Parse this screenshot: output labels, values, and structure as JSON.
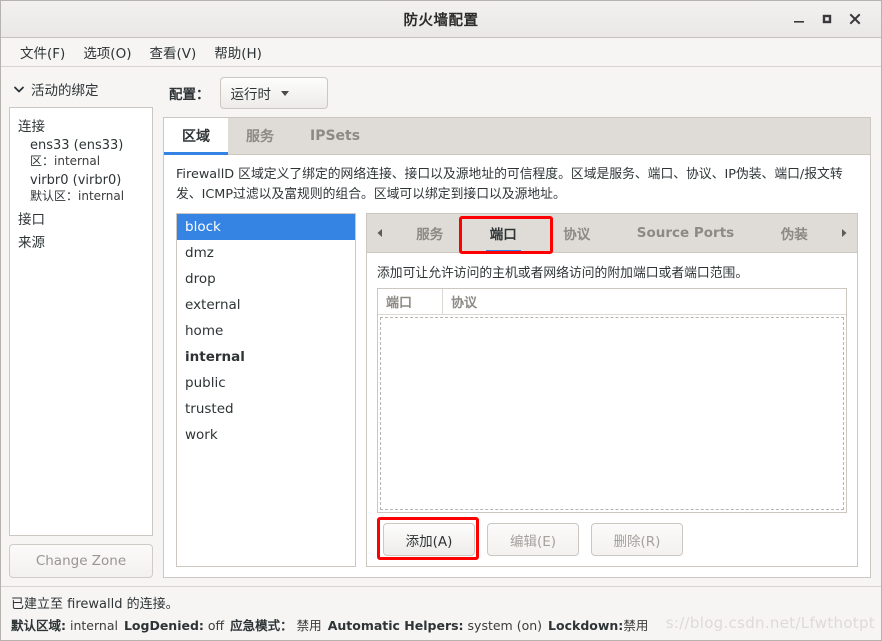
{
  "window": {
    "title": "防火墙配置",
    "controls": {
      "minimize": "—",
      "maximize": "□",
      "close": "✕"
    }
  },
  "menubar": {
    "items": [
      {
        "label": "文件(F)"
      },
      {
        "label": "选项(O)"
      },
      {
        "label": "查看(V)"
      },
      {
        "label": "帮助(H)"
      }
    ]
  },
  "sidebar": {
    "header": "活动的绑定",
    "groups": [
      {
        "title": "连接"
      },
      {
        "title": "接口"
      },
      {
        "title": "来源"
      }
    ],
    "connections": [
      {
        "name": "ens33 (ens33)",
        "sub_label": "区：",
        "sub_value": "internal"
      },
      {
        "name": "virbr0 (virbr0)",
        "sub_label": "默认区：",
        "sub_value": "internal"
      }
    ],
    "change_zone_label": "Change Zone"
  },
  "config": {
    "label": "配置：",
    "selected": "运行时"
  },
  "tabs": [
    {
      "label": "区域",
      "active": true
    },
    {
      "label": "服务",
      "active": false
    },
    {
      "label": "IPSets",
      "active": false
    }
  ],
  "zone_tab": {
    "description": "FirewallD 区域定义了绑定的网络连接、接口以及源地址的可信程度。区域是服务、端口、协议、IP伪装、端口/报文转发、ICMP过滤以及富规则的组合。区域可以绑定到接口以及源地址。",
    "zones": [
      {
        "name": "block",
        "selected": true,
        "default": false
      },
      {
        "name": "dmz",
        "selected": false,
        "default": false
      },
      {
        "name": "drop",
        "selected": false,
        "default": false
      },
      {
        "name": "external",
        "selected": false,
        "default": false
      },
      {
        "name": "home",
        "selected": false,
        "default": false
      },
      {
        "name": "internal",
        "selected": false,
        "default": true
      },
      {
        "name": "public",
        "selected": false,
        "default": false
      },
      {
        "name": "trusted",
        "selected": false,
        "default": false
      },
      {
        "name": "work",
        "selected": false,
        "default": false
      }
    ]
  },
  "inner_tabs": {
    "scroll_left": "◀",
    "scroll_right": "▶",
    "items": [
      {
        "label": "服务",
        "active": false
      },
      {
        "label": "端口",
        "active": true,
        "highlighted": true
      },
      {
        "label": "协议",
        "active": false
      },
      {
        "label": "Source Ports",
        "active": false
      },
      {
        "label": "伪装",
        "active": false
      }
    ]
  },
  "ports_panel": {
    "description": "添加可让允许访问的主机或者网络访问的附加端口或者端口范围。",
    "columns": [
      "端口",
      "协议"
    ],
    "rows": [],
    "buttons": [
      {
        "label": "添加(A)",
        "enabled": true,
        "highlighted": true
      },
      {
        "label": "编辑(E)",
        "enabled": false,
        "highlighted": false
      },
      {
        "label": "删除(R)",
        "enabled": false,
        "highlighted": false
      }
    ]
  },
  "statusbar": {
    "connection_message": "已建立至 firewalld 的连接。",
    "default_zone_label": "默认区域:",
    "default_zone_value": "internal",
    "logdenied_label": "LogDenied:",
    "logdenied_value": "off",
    "panic_label": "应急模式：",
    "panic_value": "禁用",
    "helpers_label": "Automatic Helpers:",
    "helpers_value": "system (on)",
    "lockdown_label": "Lockdown:",
    "lockdown_value": "禁用"
  },
  "watermark": "s://blog.csdn.net/Lfwthotpt",
  "colors": {
    "accent": "#3584e4",
    "highlight": "#fe0000",
    "window_bg": "#f6f5f4"
  }
}
